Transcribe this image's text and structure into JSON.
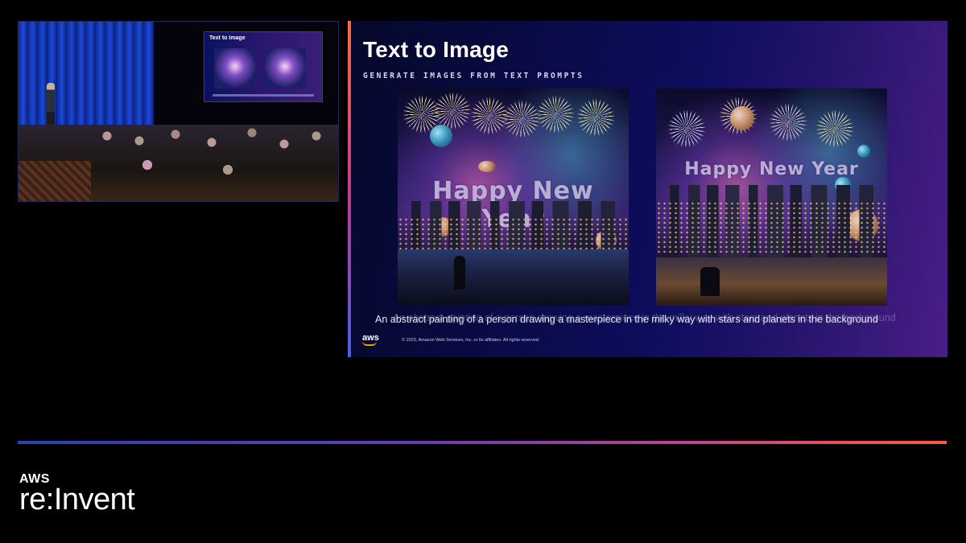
{
  "slide": {
    "title": "Text to Image",
    "subtitle": "GENERATE IMAGES FROM TEXT PROMPTS",
    "images": [
      {
        "overlay_text": "Happy New Year"
      },
      {
        "overlay_text": "Happy New Year"
      }
    ],
    "caption": "An abstract painting of a person drawing a masterpiece in the milky way with stars and planets in the background",
    "aws_logo_text": "aws",
    "copyright": "© 2023, Amazon Web Services, Inc. or its affiliates. All rights reserved."
  },
  "camera": {
    "mini_screen_title": "Text to Image"
  },
  "branding": {
    "line1": "AWS",
    "line2": "re:Invent"
  },
  "colors": {
    "accent_gradient": [
      "#2d3fb8",
      "#6a3db0",
      "#c8458c",
      "#ff5a3a"
    ],
    "slide_bg": "#0d0d5e",
    "aws_orange": "#ff9900"
  },
  "icons": {
    "aws_smile": "aws-smile-icon"
  }
}
